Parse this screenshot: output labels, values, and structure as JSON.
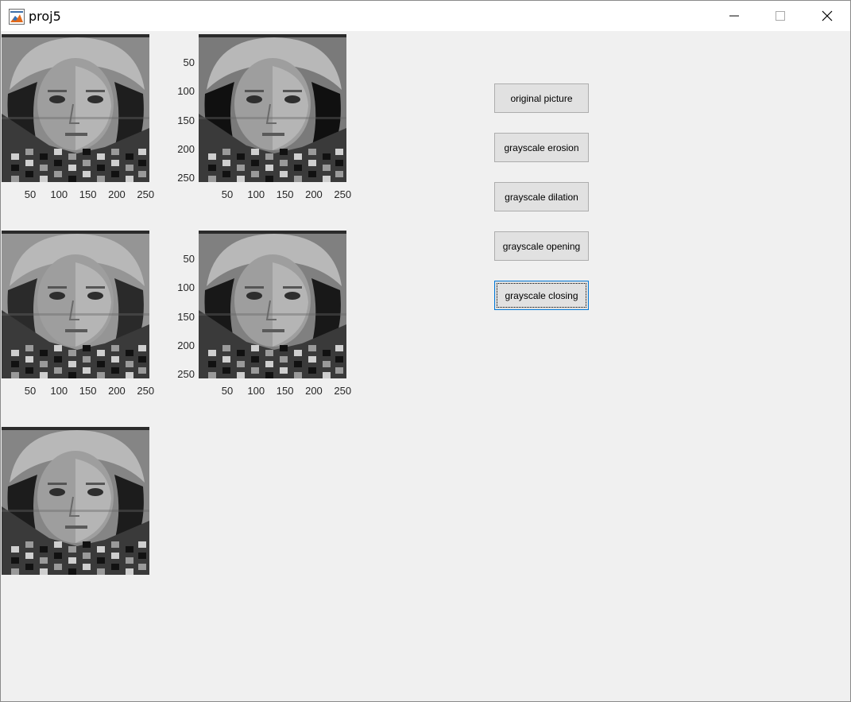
{
  "window": {
    "title": "proj5",
    "icon": "matlab-icon",
    "controls": [
      "minimize-icon",
      "maximize-icon",
      "close-icon"
    ]
  },
  "axes": [
    {
      "id": "axes-1",
      "x_ticks": [
        "50",
        "100",
        "150",
        "200",
        "250"
      ],
      "y_ticks": []
    },
    {
      "id": "axes-2",
      "x_ticks": [
        "50",
        "100",
        "150",
        "200",
        "250"
      ],
      "y_ticks": [
        "50",
        "100",
        "150",
        "200",
        "250"
      ]
    },
    {
      "id": "axes-3",
      "x_ticks": [
        "50",
        "100",
        "150",
        "200",
        "250"
      ],
      "y_ticks": []
    },
    {
      "id": "axes-4",
      "x_ticks": [
        "50",
        "100",
        "150",
        "200",
        "250"
      ],
      "y_ticks": [
        "50",
        "100",
        "150",
        "200",
        "250"
      ]
    },
    {
      "id": "axes-5",
      "x_ticks": [],
      "y_ticks": []
    }
  ],
  "buttons": {
    "original": "original picture",
    "erosion": "grayscale erosion",
    "dilation": "grayscale dilation",
    "opening": "grayscale opening",
    "closing": "grayscale closing"
  },
  "colors": {
    "focus_border": "#0078d7",
    "button_face": "#e1e1e1",
    "client_background": "#f0f0f0"
  }
}
